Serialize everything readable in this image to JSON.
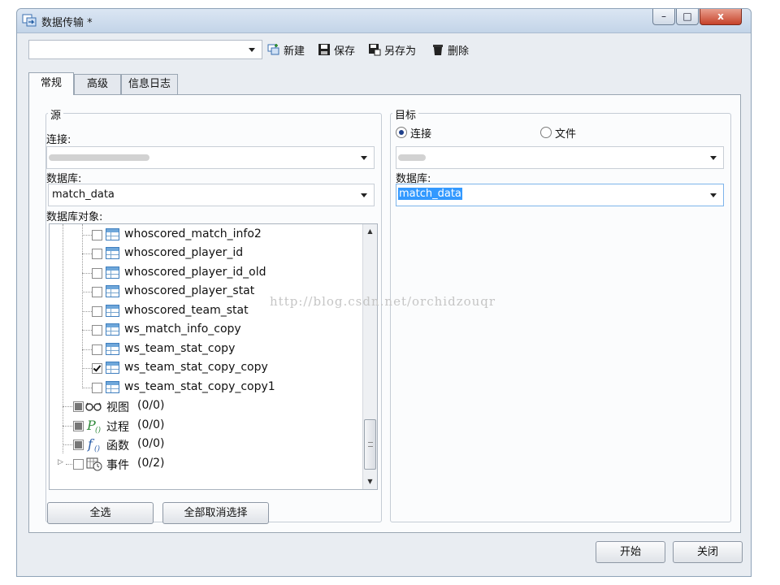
{
  "window": {
    "title": "数据传输 *",
    "controls": {
      "minimize": "–",
      "maximize": "□",
      "close": "x"
    }
  },
  "toolbar": {
    "profile_value": "",
    "new_label": "新建",
    "save_label": "保存",
    "save_as_label": "另存为",
    "delete_label": "删除"
  },
  "tabs": [
    {
      "label": "常规",
      "active": true
    },
    {
      "label": "高级",
      "active": false
    },
    {
      "label": "信息日志",
      "active": false
    }
  ],
  "source": {
    "group_label": "源",
    "connection_label": "连接:",
    "connection_value": "",
    "database_label": "数据库:",
    "database_value": "match_data",
    "objects_label": "数据库对象:",
    "tables": [
      {
        "name": "whoscored_match_info2",
        "checked": false
      },
      {
        "name": "whoscored_player_id",
        "checked": false
      },
      {
        "name": "whoscored_player_id_old",
        "checked": false
      },
      {
        "name": "whoscored_player_stat",
        "checked": false
      },
      {
        "name": "whoscored_team_stat",
        "checked": false
      },
      {
        "name": "ws_match_info_copy",
        "checked": false
      },
      {
        "name": "ws_team_stat_copy",
        "checked": false
      },
      {
        "name": "ws_team_stat_copy_copy",
        "checked": true
      },
      {
        "name": "ws_team_stat_copy_copy1",
        "checked": false
      }
    ],
    "categories": [
      {
        "icon": "glasses-icon",
        "label": "视图",
        "count": "(0/0)"
      },
      {
        "icon": "procedure-icon",
        "label": "过程",
        "count": "(0/0)"
      },
      {
        "icon": "function-icon",
        "label": "函数",
        "count": "(0/0)"
      },
      {
        "icon": "event-icon",
        "label": "事件",
        "count": "(0/2)"
      }
    ],
    "select_all_label": "全选",
    "deselect_all_label": "全部取消选择"
  },
  "target": {
    "group_label": "目标",
    "radio_connection_label": "连接",
    "radio_file_label": "文件",
    "selected_mode": "连接",
    "connection_value": "",
    "database_label": "数据库:",
    "database_value": "match_data"
  },
  "footer": {
    "start_label": "开始",
    "close_label": "关闭"
  },
  "watermark": "http://blog.csdn.net/orchidzouqr",
  "colors": {
    "accent_selection": "#3399ff",
    "close_button": "#c6422a",
    "table_icon": "#3f7fbf"
  }
}
